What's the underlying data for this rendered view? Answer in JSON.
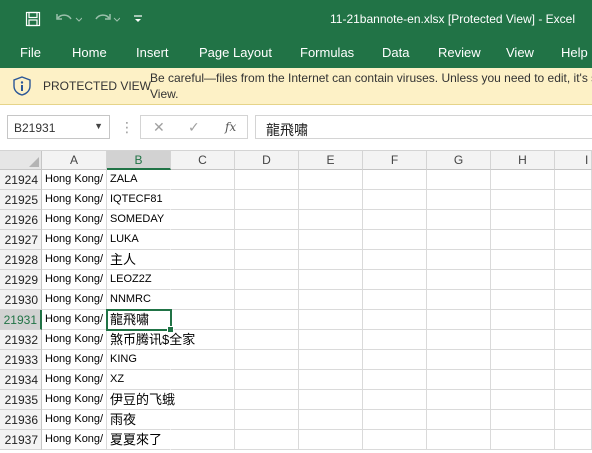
{
  "window": {
    "title": "11-21bannote-en.xlsx  [Protected View]  -  Excel"
  },
  "quick_access": {
    "save_icon": "save-icon",
    "undo_icon": "undo-icon",
    "redo_icon": "redo-icon",
    "customize_icon": "customize-icon"
  },
  "ribbon": {
    "tabs": [
      "File",
      "Home",
      "Insert",
      "Page Layout",
      "Formulas",
      "Data",
      "Review",
      "View",
      "Help"
    ]
  },
  "protected_view": {
    "title": "PROTECTED VIEW",
    "message_line1": "Be careful—files from the Internet can contain viruses. Unless you need to edit, it's sa",
    "message_line2": "View.",
    "accent": "#fdf1c6"
  },
  "formula_bar": {
    "name_box": "B21931",
    "separator": "⋮",
    "cancel_symbol": "✕",
    "enter_symbol": "✓",
    "fx_label": "fx",
    "content": "龍飛嘯"
  },
  "sheet": {
    "columns": [
      "A",
      "B",
      "C",
      "D",
      "E",
      "F",
      "G",
      "H",
      "I"
    ],
    "selected_column": "B",
    "selected_row": "21931",
    "rows": [
      {
        "num": "21924",
        "a": "Hong Kong/",
        "b": "ZALA"
      },
      {
        "num": "21925",
        "a": "Hong Kong/",
        "b": "IQTECF81"
      },
      {
        "num": "21926",
        "a": "Hong Kong/",
        "b": "SOMEDAY"
      },
      {
        "num": "21927",
        "a": "Hong Kong/",
        "b": "LUKA"
      },
      {
        "num": "21928",
        "a": "Hong Kong/",
        "b": "主人"
      },
      {
        "num": "21929",
        "a": "Hong Kong/",
        "b": "LEOZ2Z"
      },
      {
        "num": "21930",
        "a": "Hong Kong/",
        "b": "NNMRC"
      },
      {
        "num": "21931",
        "a": "Hong Kong/",
        "b": "龍飛嘯"
      },
      {
        "num": "21932",
        "a": "Hong Kong/",
        "b": "煞币腾讯$全家"
      },
      {
        "num": "21933",
        "a": "Hong Kong/",
        "b": "KING"
      },
      {
        "num": "21934",
        "a": "Hong Kong/",
        "b": "XZ"
      },
      {
        "num": "21935",
        "a": "Hong Kong/",
        "b": "伊豆的飞蛾"
      },
      {
        "num": "21936",
        "a": "Hong Kong/",
        "b": "雨夜"
      },
      {
        "num": "21937",
        "a": "Hong Kong/",
        "b": "夏夏來了"
      }
    ]
  },
  "colors": {
    "excel_green": "#217346",
    "header_gray": "#f3f3f3",
    "selected_header": "#d2d2d2"
  }
}
